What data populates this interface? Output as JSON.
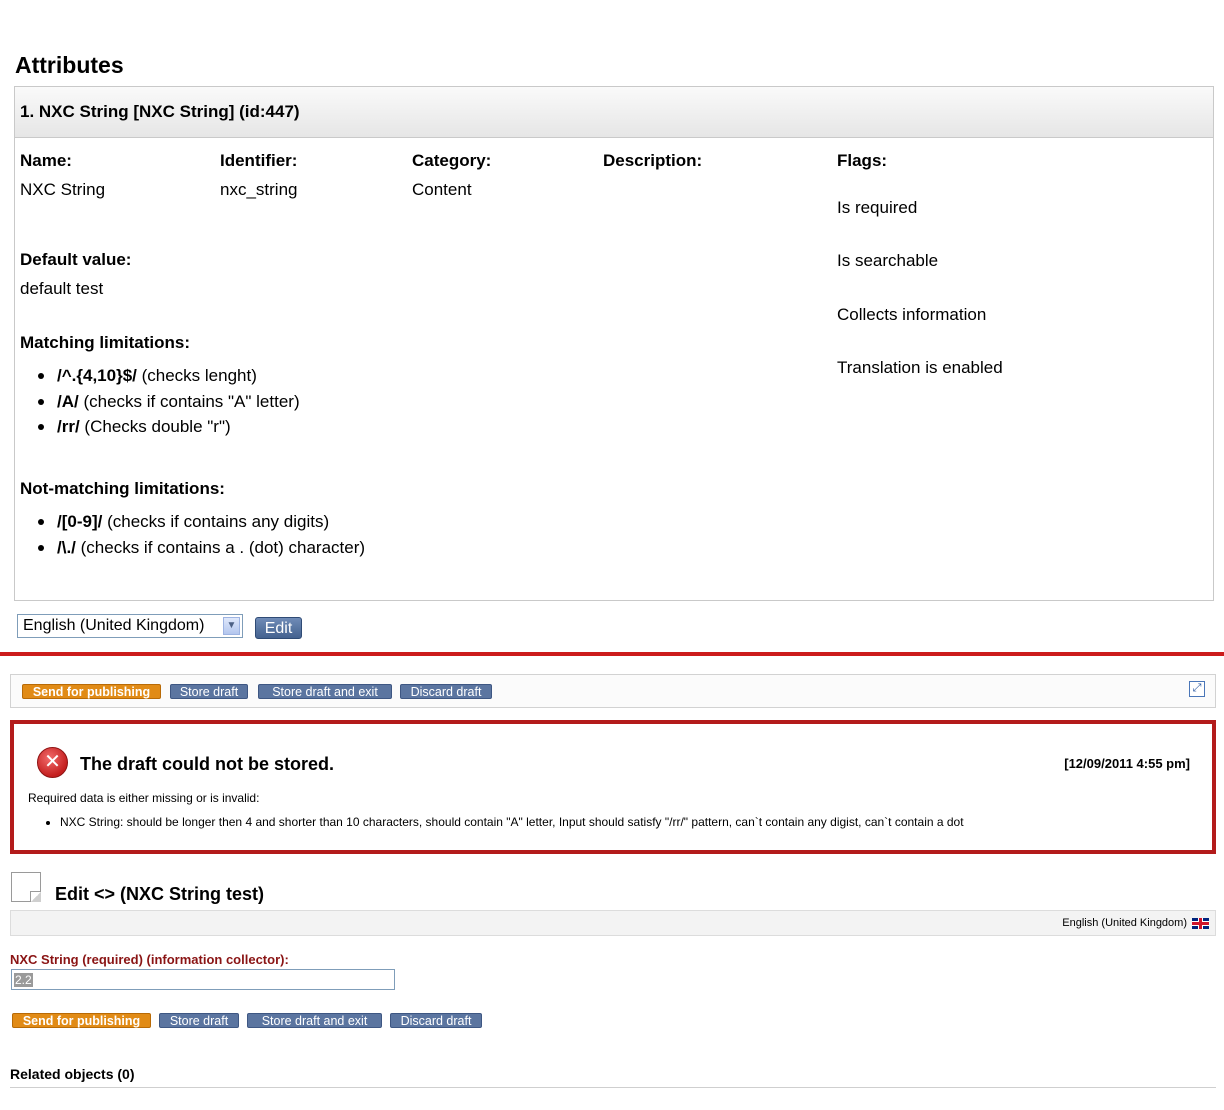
{
  "attributes": {
    "heading": "Attributes",
    "item_title": "1. NXC String [NXC String] (id:447)",
    "name_label": "Name:",
    "name_value": "NXC String",
    "identifier_label": "Identifier:",
    "identifier_value": "nxc_string",
    "category_label": "Category:",
    "category_value": "Content",
    "description_label": "Description:",
    "flags_label": "Flags:",
    "flags": [
      "Is required",
      "Is searchable",
      "Collects information",
      "Translation is enabled"
    ],
    "default_label": "Default value:",
    "default_value": "default test",
    "matching_label": "Matching limitations:",
    "matching": [
      {
        "pattern": "/^.{4,10}$/",
        "note": "(checks lenght)"
      },
      {
        "pattern": "/A/",
        "note": "(checks if contains \"A\" letter)"
      },
      {
        "pattern": "/rr/",
        "note": "(Checks double \"r\")"
      }
    ],
    "not_matching_label": "Not-matching limitations:",
    "not_matching": [
      {
        "pattern": "/[0-9]/",
        "note": "(checks if contains any digits)"
      },
      {
        "pattern": "/\\./",
        "note": "(checks if contains a . (dot) character)"
      }
    ],
    "language_select": "English (United Kingdom)",
    "edit_button": "Edit"
  },
  "toolbar": {
    "send": "Send for publishing",
    "store": "Store draft",
    "store_exit": "Store draft and exit",
    "discard": "Discard draft"
  },
  "error": {
    "title": "The draft could not be stored.",
    "timestamp": "[12/09/2011 4:55 pm]",
    "description": "Required data is either missing or is invalid:",
    "items": [
      "NXC String: should be longer then 4 and shorter than 10 characters, should contain \"A\" letter, Input should satisfy \"/rr/\" pattern, can`t contain any digist, can`t contain a dot"
    ]
  },
  "edit": {
    "title": "Edit <> (NXC String test)",
    "language": "English (United Kingdom)",
    "field_label": "NXC String (required) (information collector):",
    "field_value": "2.2"
  },
  "related": "Related objects (0)",
  "colors": {
    "accent_red": "#b31b1b",
    "button_blue": "#5b75a0",
    "button_orange": "#e18b16",
    "field_label": "#8a1414"
  }
}
